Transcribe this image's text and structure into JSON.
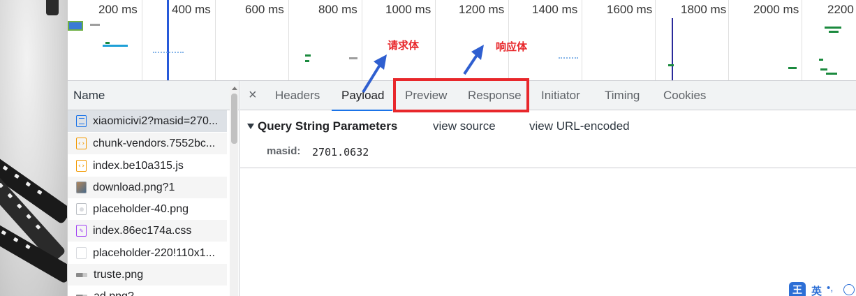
{
  "timeline": {
    "ticks": [
      "200 ms",
      "400 ms",
      "600 ms",
      "800 ms",
      "1000 ms",
      "1200 ms",
      "1400 ms",
      "1600 ms",
      "1800 ms",
      "2000 ms",
      "2200"
    ]
  },
  "network": {
    "name_header": "Name",
    "rows": [
      {
        "label": "xiaomicivi2?masid=270...",
        "icon": "document-icon"
      },
      {
        "label": "chunk-vendors.7552bc...",
        "icon": "script-icon"
      },
      {
        "label": "index.be10a315.js",
        "icon": "script-icon"
      },
      {
        "label": "download.png?1",
        "icon": "image-icon"
      },
      {
        "label": "placeholder-40.png",
        "icon": "image-placeholder-icon"
      },
      {
        "label": "index.86ec174a.css",
        "icon": "stylesheet-icon"
      },
      {
        "label": "placeholder-220!110x1...",
        "icon": "image-placeholder-icon"
      },
      {
        "label": "truste.png",
        "icon": "image-icon"
      },
      {
        "label": "ad.png?",
        "icon": "image-icon"
      }
    ]
  },
  "details": {
    "close_symbol": "×",
    "tabs": [
      "Headers",
      "Payload",
      "Preview",
      "Response",
      "Initiator",
      "Timing",
      "Cookies"
    ],
    "active_tab": "Payload",
    "query_section": {
      "title": "Query String Parameters",
      "view_source": "view source",
      "view_url_encoded": "view URL-encoded",
      "param_key": "masid:",
      "param_value": "2701.0632"
    }
  },
  "annotations": {
    "request_body": "请求体",
    "response_body": "响应体",
    "accent_color": "#e8272b",
    "arrow_color": "#2f5fd0"
  },
  "ime": {
    "logo": "王",
    "mode": "英",
    "punct": "•,"
  }
}
